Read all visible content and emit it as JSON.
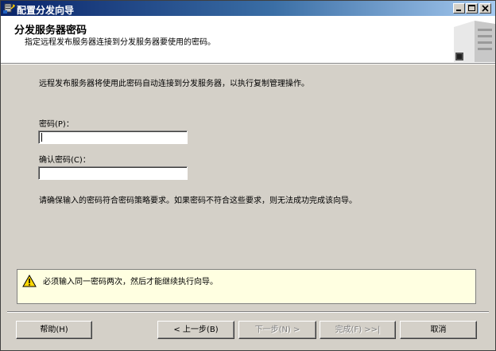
{
  "window": {
    "title": "配置分发向导"
  },
  "header": {
    "title": "分发服务器密码",
    "subtitle": "指定远程发布服务器连接到分发服务器要使用的密码。"
  },
  "content": {
    "description": "远程发布服务器将使用此密码自动连接到分发服务器，以执行复制管理操作。",
    "password_label": "密码(P)：",
    "password_value": "",
    "confirm_label": "确认密码(C)：",
    "confirm_value": "",
    "note": "请确保输入的密码符合密码策略要求。如果密码不符合这些要求，则无法成功完成该向导。"
  },
  "message": {
    "icon": "warning-icon",
    "text": "必须输入同一密码两次，然后才能继续执行向导。"
  },
  "buttons": {
    "help": "帮助(H)",
    "back": "< 上一步(B)",
    "next": "下一步(N) >",
    "finish": "完成(F) >>|",
    "cancel": "取消"
  },
  "colors": {
    "title_gradient_start": "#0a246a",
    "title_gradient_end": "#a6caf0",
    "dialog_face": "#d4d0c8",
    "message_background": "#ffffe1",
    "warning_yellow": "#ffd800"
  }
}
